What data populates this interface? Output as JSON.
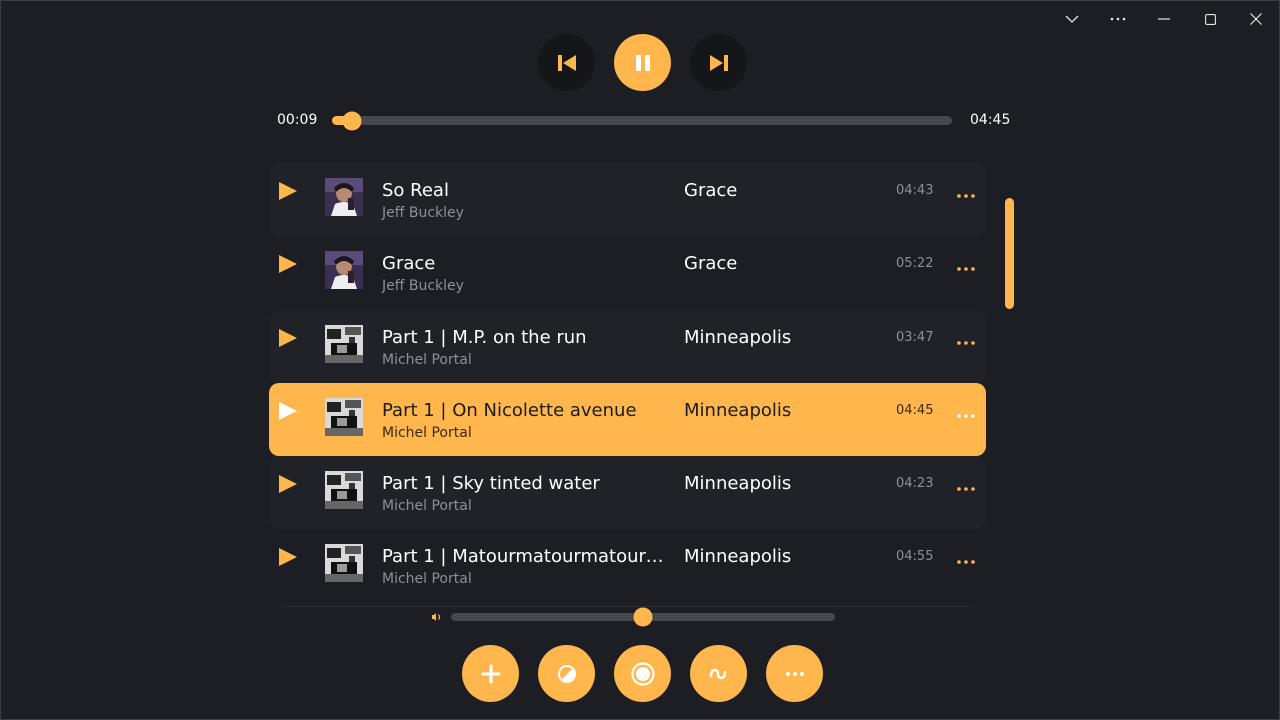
{
  "window": {
    "controls": [
      "chevron-down-icon",
      "more-horizontal-icon",
      "minimize-icon",
      "maximize-icon",
      "close-icon"
    ]
  },
  "player": {
    "current_time": "00:09",
    "total_time": "04:45",
    "progress": 0.033,
    "state": "playing"
  },
  "tracks": [
    {
      "title": "So Real",
      "artist": "Jeff Buckley",
      "album": "Grace",
      "duration": "04:43",
      "art": "jeff-buckley-grace"
    },
    {
      "title": "Grace",
      "artist": "Jeff Buckley",
      "album": "Grace",
      "duration": "05:22",
      "art": "jeff-buckley-grace"
    },
    {
      "title": "Part 1 | M.P. on the run",
      "artist": "Michel Portal",
      "album": "Minneapolis",
      "duration": "03:47",
      "art": "michel-portal-minneapolis"
    },
    {
      "title": "Part 1 | On Nicolette avenue",
      "artist": "Michel Portal",
      "album": "Minneapolis",
      "duration": "04:45",
      "art": "michel-portal-minneapolis",
      "selected": true
    },
    {
      "title": "Part 1 | Sky tinted water",
      "artist": "Michel Portal",
      "album": "Minneapolis",
      "duration": "04:23",
      "art": "michel-portal-minneapolis"
    },
    {
      "title": "Part 1 | Matourmatourmatourm...",
      "artist": "Michel Portal",
      "album": "Minneapolis",
      "duration": "04:55",
      "art": "michel-portal-minneapolis"
    }
  ],
  "volume": {
    "level": 0.5
  },
  "actions": [
    "add-icon",
    "theme-icon",
    "record-icon",
    "wave-icon",
    "more-icon"
  ],
  "colors": {
    "accent": "#ffb74d",
    "background": "#1c1e24",
    "row_alt": "#202228",
    "track": "#45474d"
  }
}
